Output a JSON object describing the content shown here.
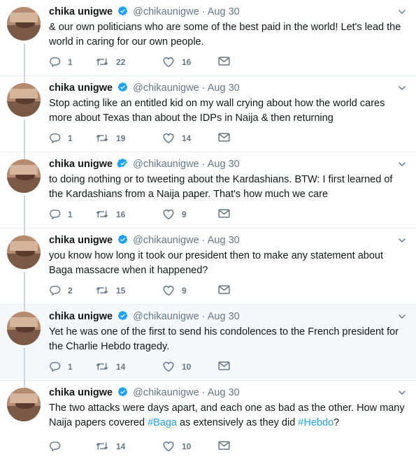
{
  "tweets": [
    {
      "name": "chika unigwe",
      "handle": "@chikaunigwe",
      "separator": "·",
      "time": "Aug 30",
      "text": "& our own politicians who are some of the best paid in the world! Let's lead the world in caring for our own people.",
      "replies": "1",
      "retweets": "22",
      "likes": "16"
    },
    {
      "name": "chika unigwe",
      "handle": "@chikaunigwe",
      "separator": "·",
      "time": "Aug 30",
      "text": "Stop acting like an entitled kid on my wall crying about how the world cares more about Texas than about the IDPs in  Naija & then returning",
      "replies": "1",
      "retweets": "19",
      "likes": "14"
    },
    {
      "name": "chika unigwe",
      "handle": "@chikaunigwe",
      "separator": "·",
      "time": "Aug 30",
      "text": "to doing nothing or to tweeting about the Kardashians. BTW: I first learned of the Kardashians from a Naija paper. That's how much we care",
      "replies": "1",
      "retweets": "16",
      "likes": "9"
    },
    {
      "name": "chika unigwe",
      "handle": "@chikaunigwe",
      "separator": "·",
      "time": "Aug 30",
      "text": "you know how long it took our president then  to make any statement about Baga massacre when it happened?",
      "replies": "2",
      "retweets": "15",
      "likes": "9"
    },
    {
      "name": "chika unigwe",
      "handle": "@chikaunigwe",
      "separator": "·",
      "time": "Aug 30",
      "text": "Yet he was one of the first to send his condolences to the French president for the Charlie Hebdo tragedy.",
      "replies": "1",
      "retweets": "14",
      "likes": "10"
    },
    {
      "name": "chika unigwe",
      "handle": "@chikaunigwe",
      "separator": "·",
      "time": "Aug 30",
      "text_part1": "The two attacks were days apart, and each one as bad as the other. How many Naija  papers covered ",
      "hashtag1": "#Baga",
      "text_part2": " as extensively as they did ",
      "hashtag2": "#Hebdo",
      "text_part3": "?",
      "replies": "",
      "retweets": "14",
      "likes": "10"
    }
  ],
  "icons": {
    "reply": "reply-icon",
    "retweet": "retweet-icon",
    "like": "heart-icon",
    "message": "envelope-icon",
    "verified": "verified-badge-icon",
    "caret": "chevron-down-icon"
  },
  "colors": {
    "text": "#14171a",
    "muted": "#657786",
    "link": "#1da1f2",
    "thread_line": "#ccd6dd",
    "highlight_bg": "#f5f8fa"
  }
}
